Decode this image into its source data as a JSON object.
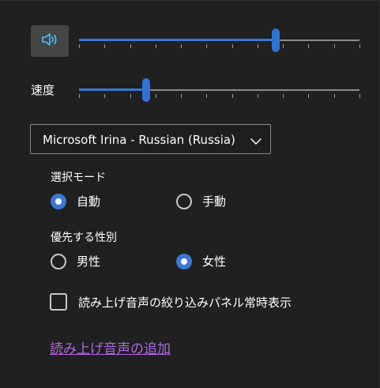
{
  "volume": {
    "button_icon": "speaker-volume-icon",
    "level_percent": 70,
    "tick_count": 12
  },
  "speed": {
    "label": "速度",
    "level_percent": 24,
    "tick_count": 12
  },
  "voice_select": {
    "selected": "Microsoft Irina - Russian (Russia)",
    "icon": "chevron-down-icon"
  },
  "selection_mode": {
    "title": "選択モード",
    "options": [
      {
        "label": "自動",
        "checked": true
      },
      {
        "label": "手動",
        "checked": false
      }
    ]
  },
  "preferred_gender": {
    "title": "優先する性別",
    "options": [
      {
        "label": "男性",
        "checked": false
      },
      {
        "label": "女性",
        "checked": true
      }
    ]
  },
  "always_show_filter": {
    "label": "読み上げ音声の絞り込みパネル常時表示",
    "checked": false
  },
  "add_voice_link": {
    "label": "読み上げ音声の追加"
  },
  "colors": {
    "accent": "#3b78d6",
    "link": "#b066e6",
    "background": "#202020"
  }
}
